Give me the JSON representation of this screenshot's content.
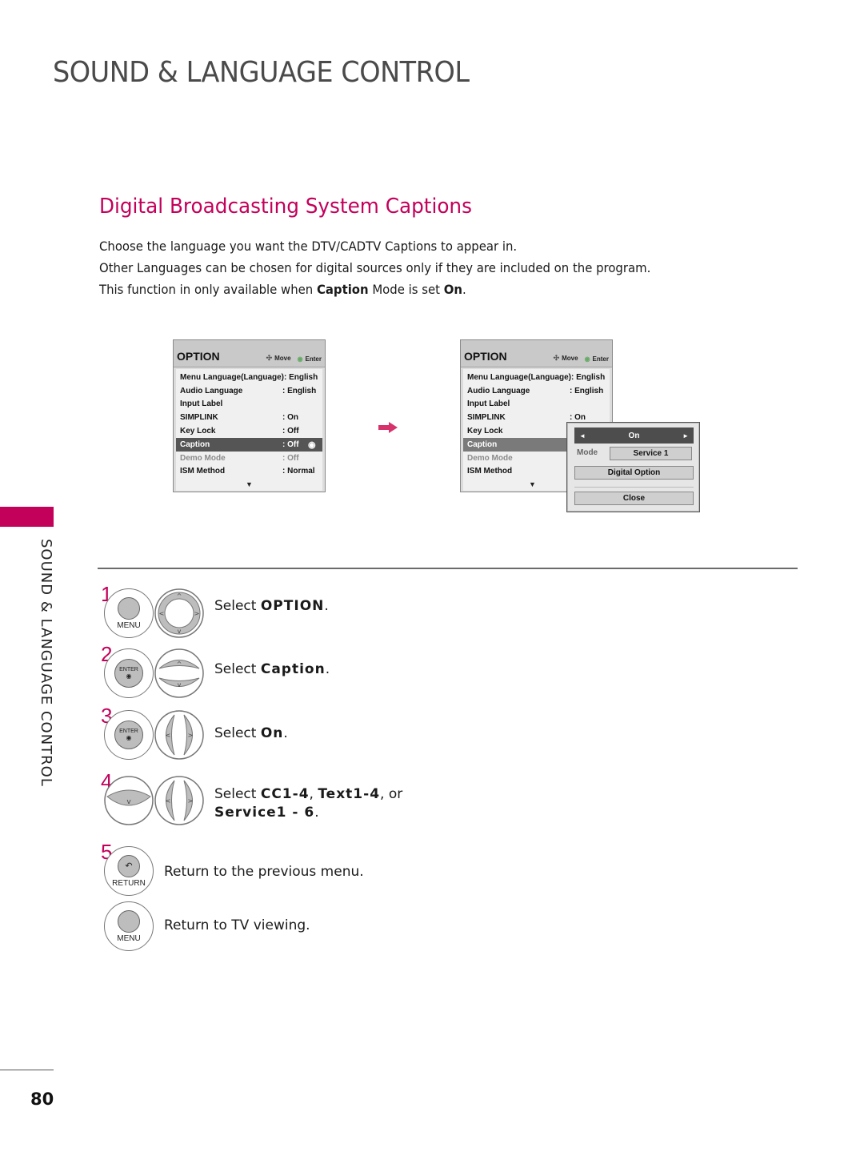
{
  "header": {
    "page_title": "SOUND & LANGUAGE CONTROL",
    "section_title": "Digital Broadcasting System Captions"
  },
  "intro": {
    "line1": "Choose the language you want the DTV/CADTV Captions to appear in.",
    "line2": "Other Languages can be chosen for digital sources only if they are included on the program.",
    "line3_pre": "This function in only available when ",
    "line3_bold1": "Caption",
    "line3_mid": " Mode is set ",
    "line3_bold2": "On",
    "line3_end": "."
  },
  "menu_left": {
    "title": "OPTION",
    "hint_move": "Move",
    "hint_enter": "Enter",
    "rows": [
      {
        "label": "Menu Language(Language): English",
        "value": ""
      },
      {
        "label": "Audio Language",
        "value": ": English"
      },
      {
        "label": "Input Label",
        "value": ""
      },
      {
        "label": "SIMPLINK",
        "value": ": On"
      },
      {
        "label": "Key Lock",
        "value": ": Off"
      },
      {
        "label": "Caption",
        "value": ": Off"
      },
      {
        "label": "Demo Mode",
        "value": ": Off"
      },
      {
        "label": "ISM Method",
        "value": ": Normal"
      }
    ],
    "more": "▼"
  },
  "menu_right": {
    "title": "OPTION",
    "hint_move": "Move",
    "hint_enter": "Enter",
    "rows": [
      {
        "label": "Menu Language(Language): English",
        "value": ""
      },
      {
        "label": "Audio Language",
        "value": ": English"
      },
      {
        "label": "Input Label",
        "value": ""
      },
      {
        "label": "SIMPLINK",
        "value": ": On"
      },
      {
        "label": "Key Lock",
        "value": ""
      },
      {
        "label": "Caption",
        "value": ""
      },
      {
        "label": "Demo Mode",
        "value": ""
      },
      {
        "label": "ISM Method",
        "value": ""
      }
    ],
    "more": "▼"
  },
  "popup": {
    "toggle_value": "On",
    "left_arrow": "◄",
    "right_arrow": "►",
    "mode_label": "Mode",
    "mode_value": "Service 1",
    "digital_option": "Digital Option",
    "close": "Close"
  },
  "sidebar": {
    "label": "SOUND & LANGUAGE CONTROL",
    "accent": "#c3005a"
  },
  "steps": [
    {
      "num": "1",
      "button": "MENU",
      "pre": "Select ",
      "bold": "OPTION",
      "post": "."
    },
    {
      "num": "2",
      "button": "ENTER",
      "pre": "Select ",
      "bold": "Caption",
      "post": "."
    },
    {
      "num": "3",
      "button": "ENTER",
      "pre": "Select ",
      "bold": "On",
      "post": "."
    },
    {
      "num": "4",
      "button": "",
      "pre": "Select ",
      "bold": "CC1-4",
      "mid1": ", ",
      "bold2": "Text1-4",
      "mid2": ", or",
      "bold3": "Service1 - 6",
      "post": "."
    },
    {
      "num": "5",
      "button": "RETURN",
      "text": "Return to the previous menu."
    },
    {
      "num": "",
      "button": "MENU",
      "text": "Return to TV viewing."
    }
  ],
  "footer": {
    "page_number": "80"
  }
}
